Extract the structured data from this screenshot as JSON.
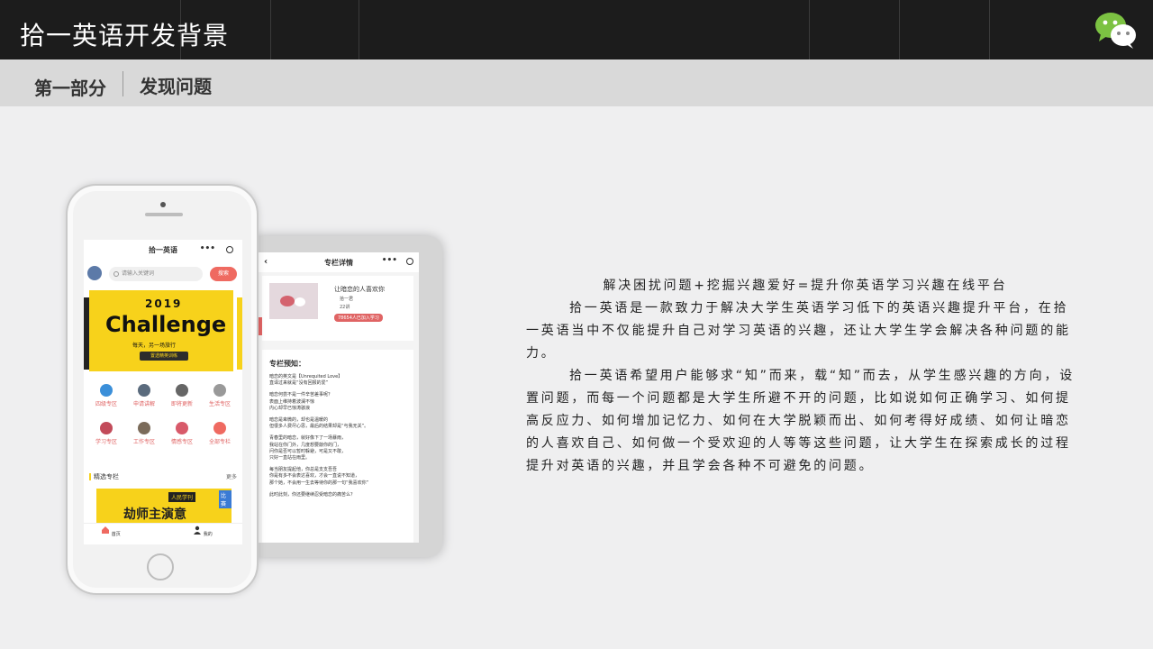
{
  "header": {
    "title": "拾一英语开发背景",
    "logo_icon": "wechat-icon"
  },
  "subheader": {
    "part": "第一部分",
    "section": "发现问题"
  },
  "phone_main": {
    "app_title": "拾一英语",
    "search_placeholder": "请输入关键词",
    "search_button": "搜索",
    "banner": {
      "year": "2019",
      "headline": "Challenge",
      "slogan": "每天，另一场旅行",
      "pill": "置透精英训练"
    },
    "categories": [
      {
        "label": "四级专区",
        "color": "#3b8fd9"
      },
      {
        "label": "申请讲解",
        "color": "#5a6b7d"
      },
      {
        "label": "即将更新",
        "color": "#666666"
      },
      {
        "label": "生活专区",
        "color": "#999999"
      },
      {
        "label": "学习专区",
        "color": "#c24b5a"
      },
      {
        "label": "工作专区",
        "color": "#7b6b5a"
      },
      {
        "label": "情感专区",
        "color": "#d85a6a"
      },
      {
        "label": "全部专栏",
        "color": "#ef6a61"
      }
    ],
    "featured": {
      "label": "精选专栏",
      "more": "更多",
      "tag": "人民学刊",
      "corner": "比赛",
      "image_title": "劫师主演意"
    },
    "tabbar": [
      {
        "label": "首页"
      },
      {
        "label": "我的"
      }
    ]
  },
  "phone_detail": {
    "title": "专栏详情",
    "card": {
      "title": "让暗恋的人喜欢你",
      "author": "拾一君",
      "lessons": "22讲",
      "joined": "78654人已加入学习"
    },
    "intro_heading": "专栏预知：",
    "paragraphs": [
      "暗恋的英文是【Unrequited Love】",
      "直译过来就是“没有回报的爱”",
      "",
      "暗恋何尝不是一件辛苦差事呢？",
      "表面上维持着波澜不惊",
      "内心却早已惊涛骇浪",
      "",
      "暗恋是卑微的，却也是温暖的",
      "但很多人费尽心思，最后的结果却是“与我无关”。",
      "",
      "青春里的暗恋，就好像下了一场暴雨，",
      "我站在你门外，几度想要敲你的门，",
      "问你是否可以暂时躲避，可是又不敢，",
      "只好一直站在雨里。",
      "",
      "每当朋友提起他，你总是支支吾吾",
      "你是有多不会表达喜欢，才会一直说不知道，",
      "那个她，不会用一生去等待你的那一句“我喜欢你”",
      "",
      "此时此刻，你还要继续忍受暗恋的痛苦么？"
    ]
  },
  "content": {
    "lead": "解决困扰问题+挖掘兴趣爱好=提升你英语学习兴趣在线平台",
    "p1": "拾一英语是一款致力于解决大学生英语学习低下的英语兴趣提升平台，在拾一英语当中不仅能提升自己对学习英语的兴趣，还让大学生学会解决各种问题的能力。",
    "p2": "拾一英语希望用户能够求“知”而来，载“知”而去，从学生感兴趣的方向，设置问题，而每一个问题都是大学生所避不开的问题，比如说如何正确学习、如何提高反应力、如何增加记忆力、如何在大学脱颖而出、如何考得好成绩、如何让暗恋的人喜欢自己、如何做一个受欢迎的人等等这些问题，让大学生在探索成长的过程提升对英语的兴趣，并且学会各种不可避免的问题。"
  }
}
